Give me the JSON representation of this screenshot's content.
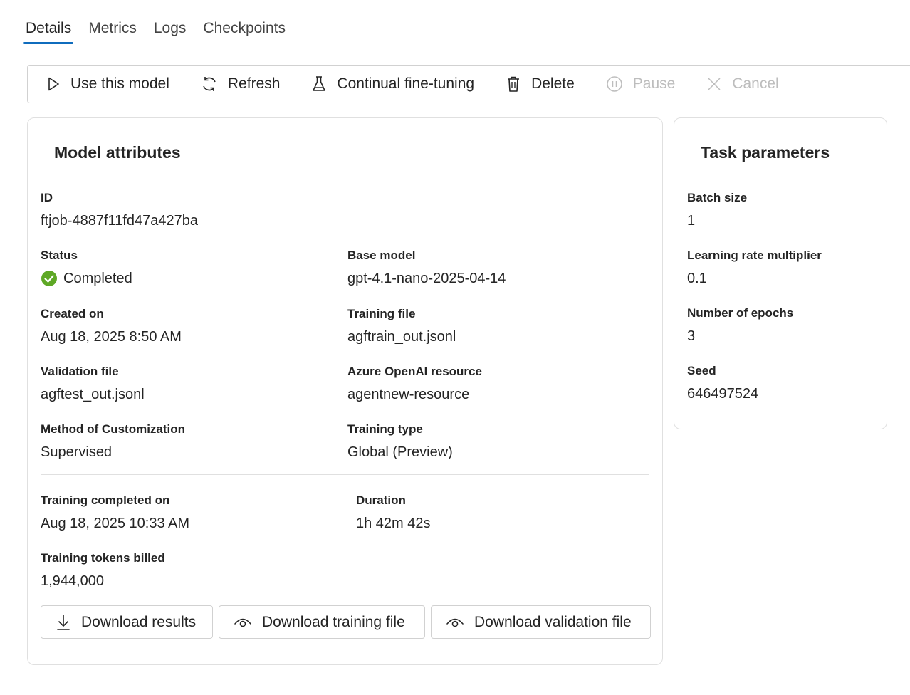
{
  "tabs": [
    {
      "label": "Details",
      "active": true
    },
    {
      "label": "Metrics"
    },
    {
      "label": "Logs"
    },
    {
      "label": "Checkpoints"
    }
  ],
  "toolbar": {
    "use_model": "Use this model",
    "refresh": "Refresh",
    "continual": "Continual fine-tuning",
    "delete": "Delete",
    "pause": "Pause",
    "cancel": "Cancel"
  },
  "model_attributes": {
    "title": "Model attributes",
    "id": {
      "label": "ID",
      "value": "ftjob-4887f11fd47a427ba"
    },
    "status": {
      "label": "Status",
      "value": "Completed",
      "color": "#5ea825"
    },
    "base_model": {
      "label": "Base model",
      "value": "gpt-4.1-nano-2025-04-14"
    },
    "created_on": {
      "label": "Created on",
      "value": "Aug 18, 2025 8:50 AM"
    },
    "training_file": {
      "label": "Training file",
      "value": "agftrain_out.jsonl"
    },
    "validation_file": {
      "label": "Validation file",
      "value": "agftest_out.jsonl"
    },
    "resource": {
      "label": "Azure OpenAI resource",
      "value": "agentnew-resource"
    },
    "method": {
      "label": "Method of Customization",
      "value": "Supervised"
    },
    "training_type": {
      "label": "Training type",
      "value": "Global (Preview)"
    },
    "completed_on": {
      "label": "Training completed on",
      "value": "Aug 18, 2025 10:33 AM"
    },
    "duration": {
      "label": "Duration",
      "value": "1h 42m 42s"
    },
    "tokens": {
      "label": "Training tokens billed",
      "value": "1,944,000"
    }
  },
  "downloads": {
    "results": "Download results",
    "training": "Download training file",
    "validation": "Download validation file"
  },
  "task_parameters": {
    "title": "Task parameters",
    "batch_size": {
      "label": "Batch size",
      "value": "1"
    },
    "lr_multiplier": {
      "label": "Learning rate multiplier",
      "value": "0.1"
    },
    "epochs": {
      "label": "Number of epochs",
      "value": "3"
    },
    "seed": {
      "label": "Seed",
      "value": "646497524"
    }
  },
  "colors": {
    "accent": "#0f6cbd",
    "success": "#5ea825",
    "border": "#d1d1d1"
  }
}
